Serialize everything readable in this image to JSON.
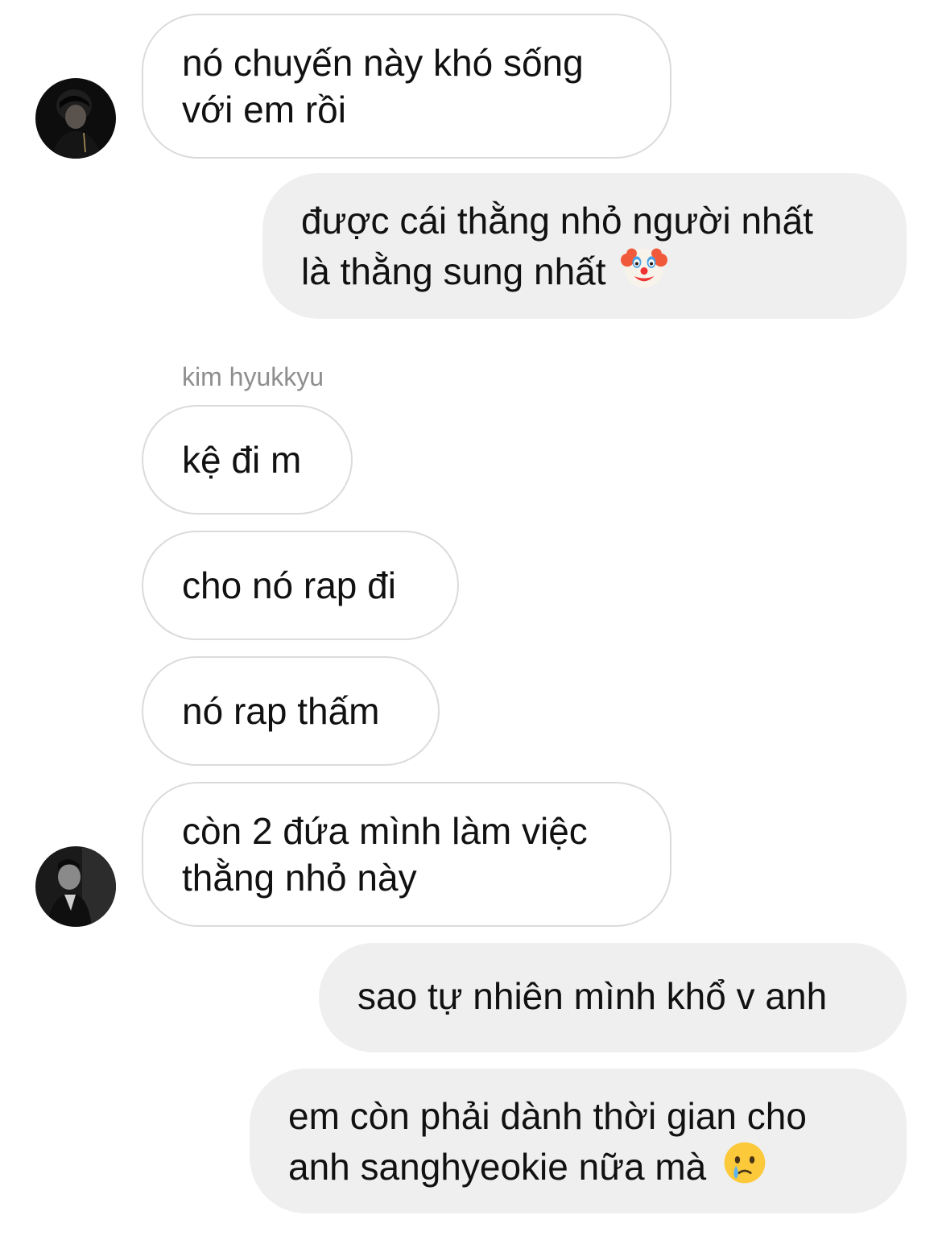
{
  "chat": {
    "sender_name": "kim hyukkyu",
    "messages": [
      {
        "lines": [
          "nó chuyến này khó sống",
          "với em rồi"
        ]
      },
      {
        "lines": [
          "được cái thằng nhỏ người nhất",
          "là thằng sung nhất"
        ],
        "emoji": "clown-face-emoji"
      },
      {
        "lines": [
          "kệ đi m"
        ]
      },
      {
        "lines": [
          "cho nó rap đi"
        ]
      },
      {
        "lines": [
          "nó rap thấm"
        ]
      },
      {
        "lines": [
          "còn 2 đứa mình làm việc",
          "thằng nhỏ này"
        ]
      },
      {
        "lines": [
          "sao tự nhiên mình khổ v anh"
        ]
      },
      {
        "lines": [
          "em còn phải dành thời gian cho",
          "anh sanghyeokie nữa mà"
        ],
        "emoji": "crying-face-emoji"
      }
    ]
  },
  "colors": {
    "incoming_border": "#dbdbdb",
    "outgoing_bg": "#efefef",
    "sender_name": "#8e8e8e",
    "text": "#111111"
  }
}
